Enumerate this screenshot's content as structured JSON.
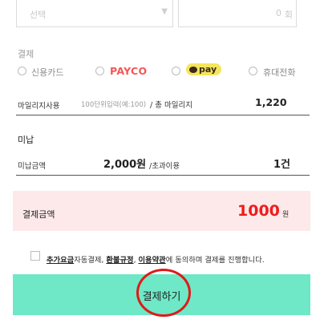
{
  "top_row": {
    "select_placeholder": "선택",
    "count_placeholder": "0",
    "count_unit": "회"
  },
  "payment_method": {
    "label": "결제",
    "options": [
      {
        "label": "신용카드",
        "selected": false
      },
      {
        "label": "PAYCO",
        "selected": false
      },
      {
        "label": "pay",
        "selected": false
      },
      {
        "label": "휴대전화",
        "selected": false
      }
    ]
  },
  "mileage": {
    "label": "마일리지사용",
    "hint": "100단위입력(예:100)",
    "total_label": "/ 총 마일리지",
    "total_value": "1,220"
  },
  "unpaid": {
    "title": "미납",
    "amount_label": "미납금액",
    "amount_value": "2,000원",
    "over_label": "/초과이용",
    "count_value": "1건"
  },
  "payment_total": {
    "label": "결제금액",
    "amount": "1000",
    "unit": "원"
  },
  "agreement": {
    "link1": "추가요금",
    "text1": "자동결제, ",
    "link2": "환불규정",
    "sep": ", ",
    "link3": "이용약관",
    "text2": "에 동의하며 결제를 진행합니다."
  },
  "submit_label": "결제하기",
  "colors": {
    "button_bg": "#6ee8c6",
    "total_bg": "#fde9e9",
    "amount_red": "#ee1c1c",
    "payco_red": "#f45656",
    "kakao_yellow": "#f5e55c",
    "highlight_circle": "#e11919"
  }
}
